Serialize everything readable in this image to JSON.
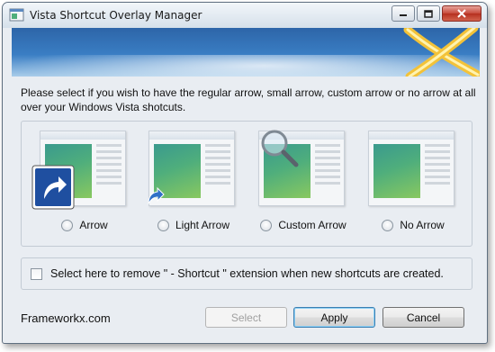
{
  "window": {
    "title": "Vista Shortcut Overlay Manager"
  },
  "instructions": "Please select if you wish to have the regular arrow, small arrow, custom arrow or no arrow at all over your Windows Vista shotcuts.",
  "options": [
    {
      "label": "Arrow",
      "icon": "large-shortcut-arrow-icon",
      "selected": false
    },
    {
      "label": "Light Arrow",
      "icon": "small-shortcut-arrow-icon",
      "selected": false
    },
    {
      "label": "Custom Arrow",
      "icon": "magnifier-icon",
      "selected": false
    },
    {
      "label": "No Arrow",
      "icon": "none",
      "selected": false
    }
  ],
  "checkbox": {
    "label": "Select here to remove \" - Shortcut \" extension when new shortcuts are created.",
    "checked": false
  },
  "footer": {
    "link": "Frameworkx.com",
    "buttons": {
      "select": "Select",
      "apply": "Apply",
      "cancel": "Cancel"
    }
  },
  "colors": {
    "banner": "#3a7ec4",
    "close_button": "#c7493a",
    "default_button_border": "#3c7fb1"
  }
}
